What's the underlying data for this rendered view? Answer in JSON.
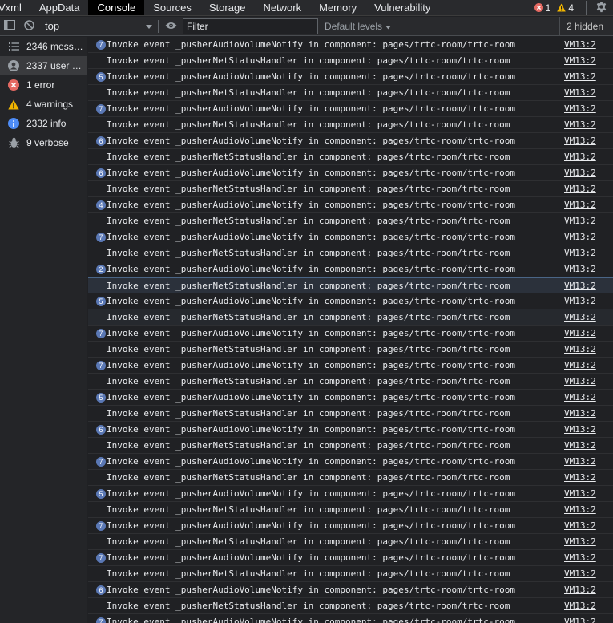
{
  "tabs": [
    {
      "label": "Vxml",
      "active": false
    },
    {
      "label": "AppData",
      "active": false
    },
    {
      "label": "Console",
      "active": true
    },
    {
      "label": "Sources",
      "active": false
    },
    {
      "label": "Storage",
      "active": false
    },
    {
      "label": "Network",
      "active": false
    },
    {
      "label": "Memory",
      "active": false
    },
    {
      "label": "Vulnerability",
      "active": false
    }
  ],
  "status": {
    "error_count": "1",
    "warning_count": "4",
    "error_color": "#e46962",
    "warning_color": "#f2b600"
  },
  "toolbar": {
    "context": "top",
    "filter_placeholder": "Filter",
    "levels_label": "Default levels",
    "hidden_label": "2 hidden"
  },
  "sidebar": {
    "items": [
      {
        "label": "2346 messa...",
        "icon": "list-icon",
        "selected": false
      },
      {
        "label": "2337 user m...",
        "icon": "user-icon",
        "selected": true
      },
      {
        "label": "1 error",
        "icon": "error-icon",
        "selected": false
      },
      {
        "label": "4 warnings",
        "icon": "warning-icon",
        "selected": false
      },
      {
        "label": "2332 info",
        "icon": "info-icon",
        "selected": false
      },
      {
        "label": "9 verbose",
        "icon": "bug-icon",
        "selected": false
      }
    ]
  },
  "log": {
    "source": "VM13:2",
    "audio_msg": "Invoke event _pusherAudioVolumeNotify in component: pages/trtc-room/trtc-room",
    "net_msg": "Invoke event _pusherNetStatusHandler in component: pages/trtc-room/trtc-room",
    "rows": [
      {
        "kind": "audio",
        "count": "7"
      },
      {
        "kind": "net",
        "count": ""
      },
      {
        "kind": "audio",
        "count": "5"
      },
      {
        "kind": "net",
        "count": ""
      },
      {
        "kind": "audio",
        "count": "7"
      },
      {
        "kind": "net",
        "count": ""
      },
      {
        "kind": "audio",
        "count": "6"
      },
      {
        "kind": "net",
        "count": ""
      },
      {
        "kind": "audio",
        "count": "6"
      },
      {
        "kind": "net",
        "count": ""
      },
      {
        "kind": "audio",
        "count": "4"
      },
      {
        "kind": "net",
        "count": ""
      },
      {
        "kind": "audio",
        "count": "7"
      },
      {
        "kind": "net",
        "count": ""
      },
      {
        "kind": "audio",
        "count": "2"
      },
      {
        "kind": "net",
        "count": "",
        "highlight": true
      },
      {
        "kind": "audio",
        "count": "5"
      },
      {
        "kind": "net",
        "count": "",
        "highlight2": true
      },
      {
        "kind": "audio",
        "count": "7"
      },
      {
        "kind": "net",
        "count": ""
      },
      {
        "kind": "audio",
        "count": "7"
      },
      {
        "kind": "net",
        "count": ""
      },
      {
        "kind": "audio",
        "count": "5"
      },
      {
        "kind": "net",
        "count": ""
      },
      {
        "kind": "audio",
        "count": "6"
      },
      {
        "kind": "net",
        "count": ""
      },
      {
        "kind": "audio",
        "count": "7"
      },
      {
        "kind": "net",
        "count": ""
      },
      {
        "kind": "audio",
        "count": "5"
      },
      {
        "kind": "net",
        "count": ""
      },
      {
        "kind": "audio",
        "count": "7"
      },
      {
        "kind": "net",
        "count": ""
      },
      {
        "kind": "audio",
        "count": "7"
      },
      {
        "kind": "net",
        "count": ""
      },
      {
        "kind": "audio",
        "count": "6"
      },
      {
        "kind": "net",
        "count": ""
      },
      {
        "kind": "audio",
        "count": "7"
      }
    ]
  }
}
